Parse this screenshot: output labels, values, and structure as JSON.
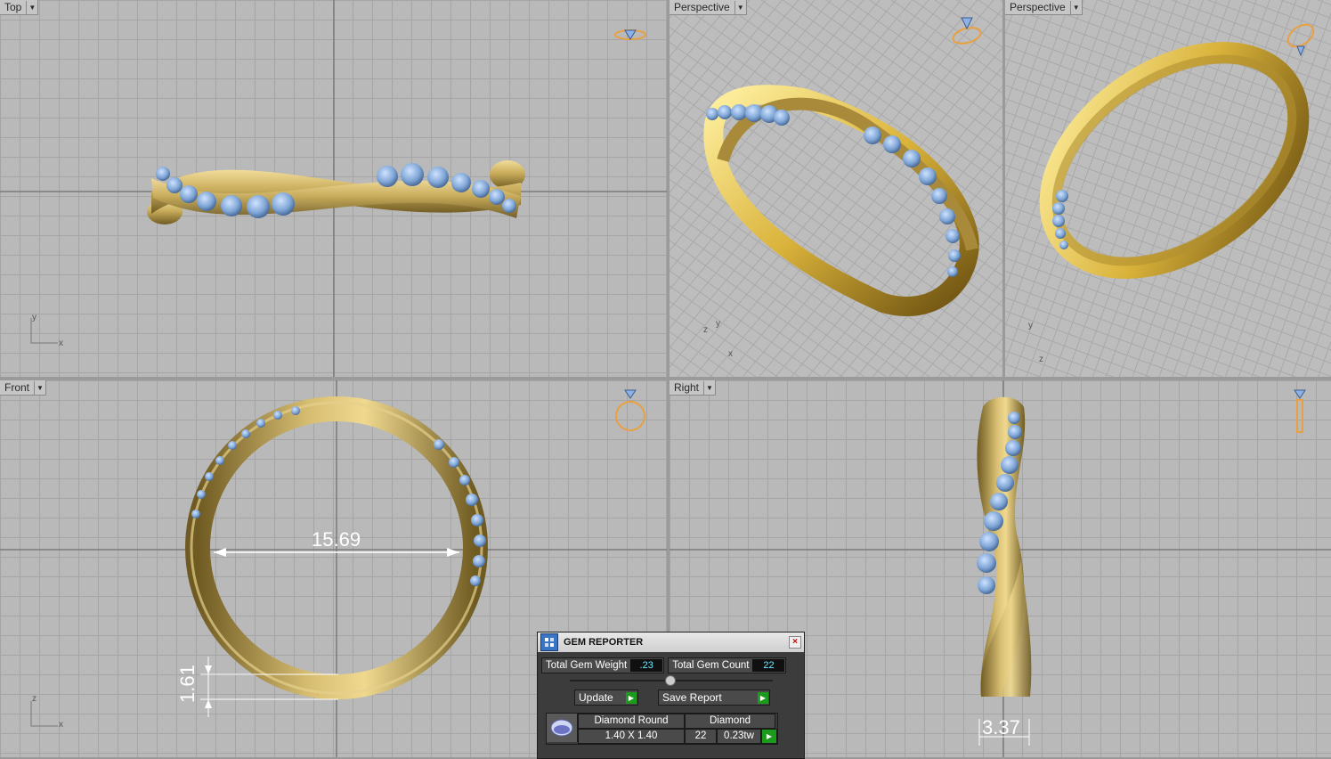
{
  "viewports": {
    "top": {
      "label": "Top",
      "axes": {
        "y": "y",
        "x": "x"
      }
    },
    "persp1": {
      "label": "Perspective",
      "axes": {
        "z": "z",
        "y": "y",
        "x": "x"
      }
    },
    "persp2": {
      "label": "Perspective",
      "axes": {
        "y": "y",
        "z": "z"
      }
    },
    "front": {
      "label": "Front",
      "axes": {
        "z": "z",
        "x": "x"
      },
      "dimensions": {
        "inner_diameter": "15.69",
        "band_thickness": "1.61"
      }
    },
    "right": {
      "label": "Right",
      "dimensions": {
        "band_width": "3.37"
      }
    }
  },
  "gem_reporter": {
    "title": "GEM REPORTER",
    "total_weight_label": "Total Gem Weight",
    "total_weight_value": ".23",
    "total_count_label": "Total Gem Count",
    "total_count_value": "22",
    "update_label": "Update",
    "save_label": "Save Report",
    "gem": {
      "name": "Diamond Round",
      "material": "Diamond",
      "size": "1.40 X 1.40",
      "count": "22",
      "weight": "0.23tw"
    }
  },
  "colors": {
    "gold": "#c9ad5c",
    "gem": "#7fa6d6",
    "gizmo": "#e8a040",
    "viewport_bg": "#b9b9b9"
  }
}
